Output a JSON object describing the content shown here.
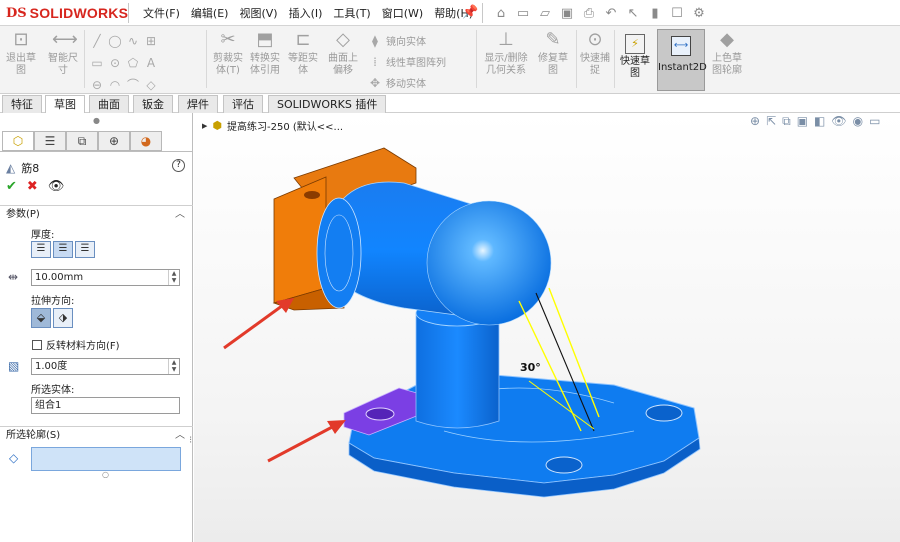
{
  "app": {
    "logo_ds": "DS",
    "logo_name": "SOLIDWORKS"
  },
  "menu": [
    "文件(F)",
    "编辑(E)",
    "视图(V)",
    "插入(I)",
    "工具(T)",
    "窗口(W)",
    "帮助(H)"
  ],
  "ribbon": {
    "exit_sketch": "退出草\n图",
    "smart_dim": "智能尺\n寸",
    "trim": "剪裁实\n体(T)",
    "convert": "转换实\n体引用",
    "offset": "等距实\n体",
    "offset_surface": "曲面上\n偏移",
    "mirror": "镜向实体",
    "linear_pattern": "线性草图阵列",
    "move": "移动实体",
    "display_relations": "显示/删除\n几何关系",
    "repair": "修复草\n图",
    "quick_snap": "快速捕\n捉",
    "quick_sketch": "快速草\n图",
    "instant2d": "Instant2D",
    "color_contour": "上色草\n图轮廓"
  },
  "tabs": [
    "特征",
    "草图",
    "曲面",
    "钣金",
    "焊件",
    "评估",
    "SOLIDWORKS 插件"
  ],
  "active_tab": "草图",
  "panel": {
    "feature_name": "筋8",
    "params_title": "参数(P)",
    "thickness_label": "厚度:",
    "thickness_value": "10.00mm",
    "direction_label": "拉伸方向:",
    "flip_label": "反转材料方向(F)",
    "draft_value": "1.00度",
    "bodies_label": "所选实体:",
    "bodies_value": "组合1",
    "profiles_title": "所选轮廓(S)"
  },
  "viewport": {
    "tree_item": "提高练习-250 (默认<<...",
    "angle_label": "30°"
  },
  "colors": {
    "accent": "#2d6fc4",
    "part_blue": "#0f7cf0",
    "orange": "#f07d0a",
    "purple": "#7b3fe4",
    "arrow": "#e23a2a"
  }
}
